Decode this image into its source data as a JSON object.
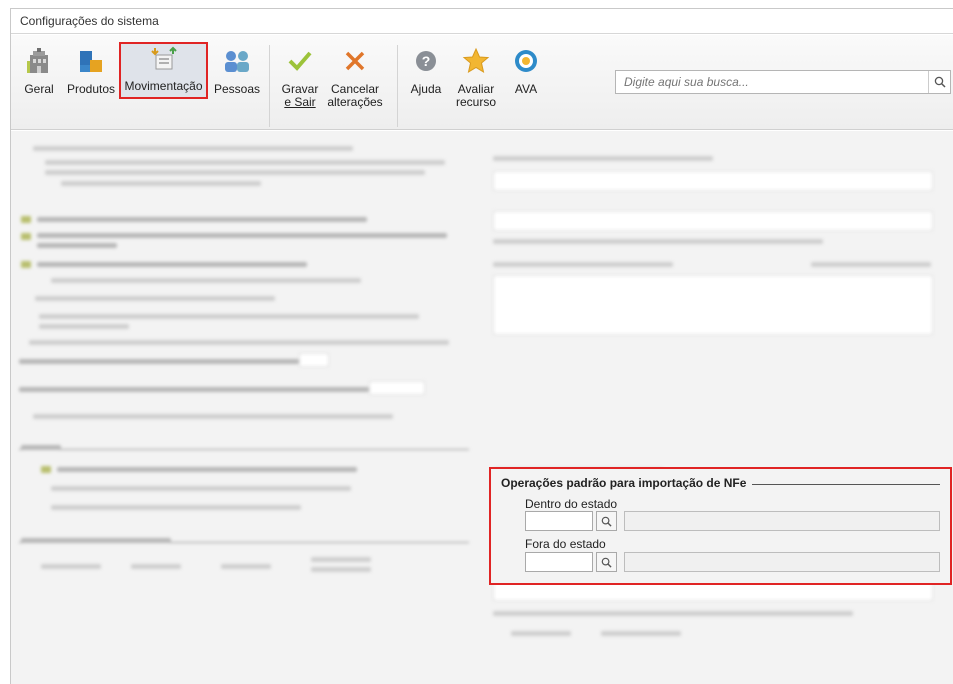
{
  "window": {
    "title": "Configurações do sistema"
  },
  "ribbon": {
    "buttons": [
      {
        "id": "geral",
        "label": "Geral",
        "icon": "building-icon"
      },
      {
        "id": "produtos",
        "label": "Produtos",
        "icon": "boxes-icon"
      },
      {
        "id": "movimentacao",
        "label": "Movimentação",
        "icon": "movement-icon",
        "active": true
      },
      {
        "id": "pessoas",
        "label": "Pessoas",
        "icon": "people-icon"
      },
      {
        "id": "gravar",
        "label_line1": "Gravar",
        "label_line2": "e Sair",
        "icon": "check-icon"
      },
      {
        "id": "cancelar",
        "label_line1": "Cancelar",
        "label_line2": "alterações",
        "icon": "close-icon"
      },
      {
        "id": "ajuda",
        "label": "Ajuda",
        "icon": "help-icon"
      },
      {
        "id": "avaliar",
        "label_line1": "Avaliar",
        "label_line2": "recurso",
        "icon": "star-icon"
      },
      {
        "id": "ava",
        "label": "AVA",
        "icon": "ava-icon"
      }
    ],
    "search": {
      "placeholder": "Digite aqui sua busca..."
    }
  },
  "nfe": {
    "title": "Operações padrão para importação de NFe",
    "dentro_label": "Dentro do estado",
    "dentro_code": "",
    "dentro_desc": "",
    "fora_label": "Fora do estado",
    "fora_code": "",
    "fora_desc": ""
  },
  "colors": {
    "highlight": "#e02424",
    "check": "#9cc33a",
    "cancel": "#e0762a",
    "star": "#f2b632",
    "active_bg": "#dfe3ea"
  }
}
